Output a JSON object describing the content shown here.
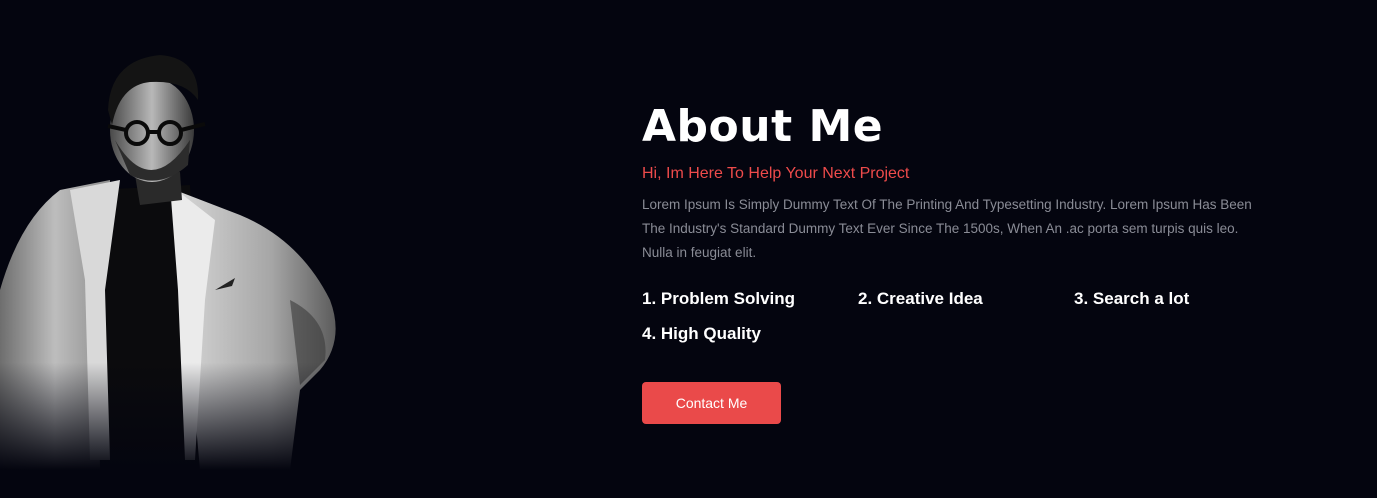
{
  "about": {
    "title": "About Me",
    "subtitle": "Hi, Im Here To Help Your Next Project",
    "description": "Lorem Ipsum Is Simply Dummy Text Of The Printing And Typesetting Industry. Lorem Ipsum Has Been The Industry's Standard Dummy Text Ever Since The 1500s, When An .ac porta sem turpis quis leo. Nulla in feugiat elit.",
    "skills": [
      "1. Problem Solving",
      "2. Creative Idea",
      "3. Search a lot",
      "4. High Quality"
    ],
    "button_label": "Contact Me"
  },
  "colors": {
    "background": "#04050f",
    "accent": "#ea4a4a",
    "subtitle": "#ee4b4b",
    "body_text": "#8a8c96"
  }
}
